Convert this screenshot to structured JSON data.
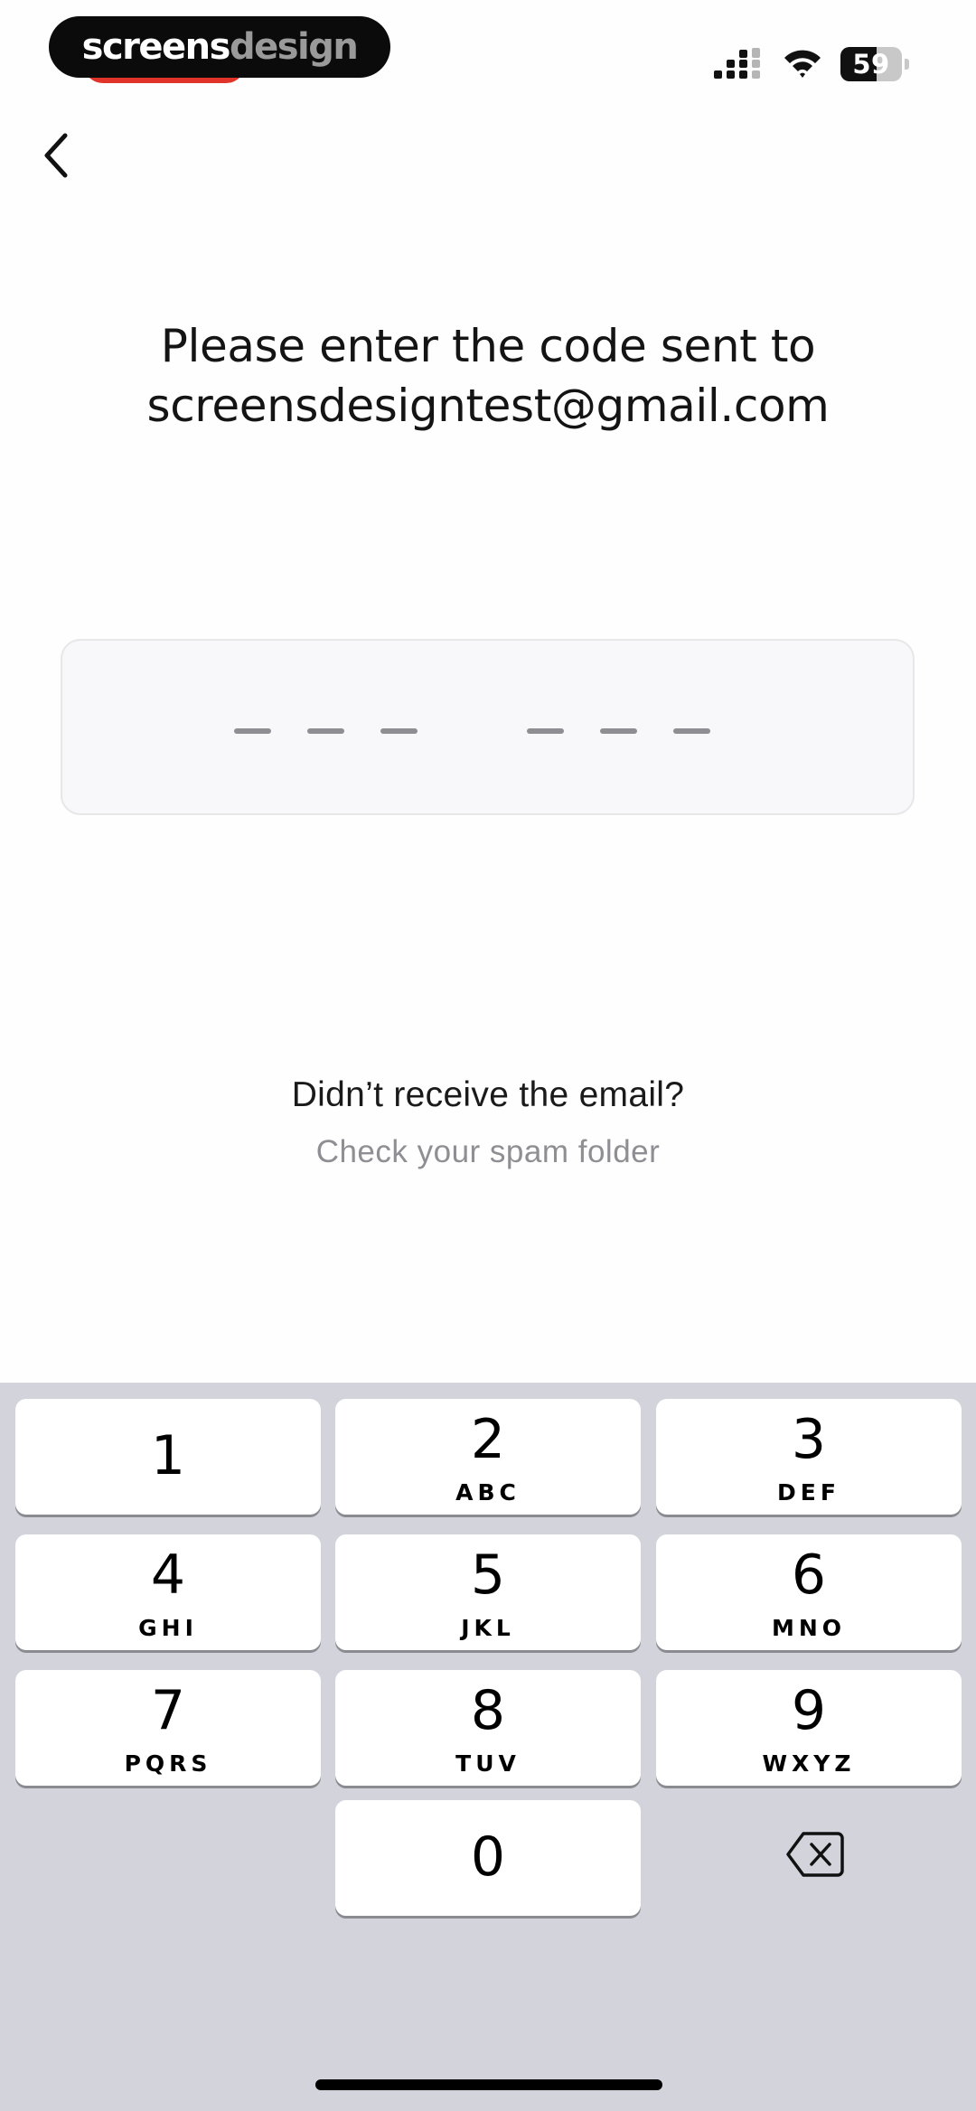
{
  "status_bar": {
    "brand_primary": "screens",
    "brand_secondary": "design",
    "battery_level": "59",
    "battery_fraction": 0.59,
    "icons": [
      "cellular-signal-icon",
      "wifi-icon",
      "battery-icon"
    ]
  },
  "nav": {
    "back_icon": "chevron-left-icon"
  },
  "header": {
    "line1": "Please enter the code sent to",
    "line2": "screensdesigntest@gmail.com"
  },
  "code_input": {
    "digit_count": 6,
    "entered_value": ""
  },
  "help": {
    "title": "Didn’t receive the email?",
    "subtitle": "Check your spam folder"
  },
  "keyboard": {
    "keys": [
      {
        "digit": "1",
        "letters": ""
      },
      {
        "digit": "2",
        "letters": "ABC"
      },
      {
        "digit": "3",
        "letters": "DEF"
      },
      {
        "digit": "4",
        "letters": "GHI"
      },
      {
        "digit": "5",
        "letters": "JKL"
      },
      {
        "digit": "6",
        "letters": "MNO"
      },
      {
        "digit": "7",
        "letters": "PQRS"
      },
      {
        "digit": "8",
        "letters": "TUV"
      },
      {
        "digit": "9",
        "letters": "WXYZ"
      },
      {
        "digit": "0",
        "letters": ""
      }
    ],
    "delete_icon": "backspace-icon"
  },
  "colors": {
    "background": "#fefefe",
    "keyboard_bg": "#d2d3db",
    "key_bg": "#ffffff",
    "text_primary": "#141414",
    "text_secondary": "#8e8e93",
    "accent_red": "#e0342b"
  }
}
